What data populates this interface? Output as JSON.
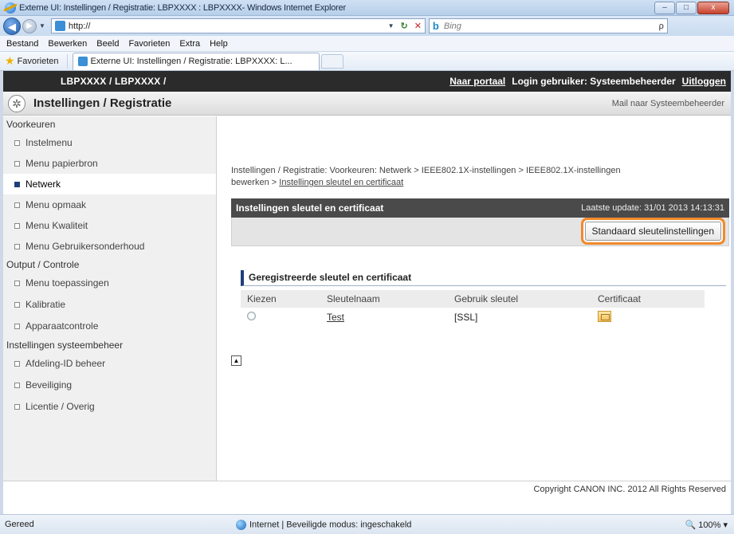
{
  "window": {
    "title": "Externe UI: Instellingen / Registratie: LBPXXXX : LBPXXXX- Windows Internet Explorer",
    "minimize": "–",
    "maximize": "□",
    "close": "x"
  },
  "address": {
    "url": "http://",
    "search_placeholder": "Bing",
    "search_glyph": "ρ"
  },
  "menu": [
    "Bestand",
    "Bewerken",
    "Beeld",
    "Favorieten",
    "Extra",
    "Help"
  ],
  "favorites": {
    "button": "Favorieten",
    "tab_title": "Externe UI: Instellingen / Registratie: LBPXXXX: L..."
  },
  "header": {
    "device": "LBPXXXX / LBPXXXX /",
    "portal": "Naar portaal",
    "login": "Login gebruiker: Systeembeheerder",
    "logout": "Uitloggen"
  },
  "band": {
    "title": "Instellingen / Registratie",
    "mail": "Mail naar Systeembeheerder"
  },
  "sidebar": {
    "section1": "Voorkeuren",
    "items1": [
      "Instelmenu",
      "Menu papierbron",
      "Netwerk",
      "Menu opmaak",
      "Menu Kwaliteit",
      "Menu Gebruikersonderhoud"
    ],
    "section2": "Output / Controle",
    "items2": [
      "Menu toepassingen",
      "Kalibratie",
      "Apparaatcontrole"
    ],
    "section3": "Instellingen systeembeheer",
    "items3": [
      "Afdeling-ID beheer",
      "Beveiliging",
      "Licentie / Overig"
    ]
  },
  "breadcrumb": {
    "part1": "Instellingen / Registratie: Voorkeuren: Netwerk",
    "sep": ">",
    "part2": "IEEE802.1X-instellingen",
    "part3": "IEEE802.1X-instellingen",
    "part4": "bewerken",
    "part5": "Instellingen sleutel en certificaat"
  },
  "panel": {
    "title": "Instellingen sleutel en certificaat",
    "last_update": "Laatste update: 31/01 2013 14:13:31",
    "default_button": "Standaard sleutelinstellingen"
  },
  "registered": {
    "title": "Geregistreerde sleutel en certificaat",
    "columns": [
      "Kiezen",
      "Sleutelnaam",
      "Gebruik sleutel",
      "Certificaat"
    ],
    "rows": [
      {
        "name": "Test",
        "usage": "[SSL]"
      }
    ]
  },
  "to_top": "▲",
  "copyright": "Copyright CANON INC. 2012 All Rights Reserved",
  "status": {
    "ready": "Gereed",
    "zone": "Internet | Beveiligde modus: ingeschakeld",
    "zoom": "100%"
  }
}
